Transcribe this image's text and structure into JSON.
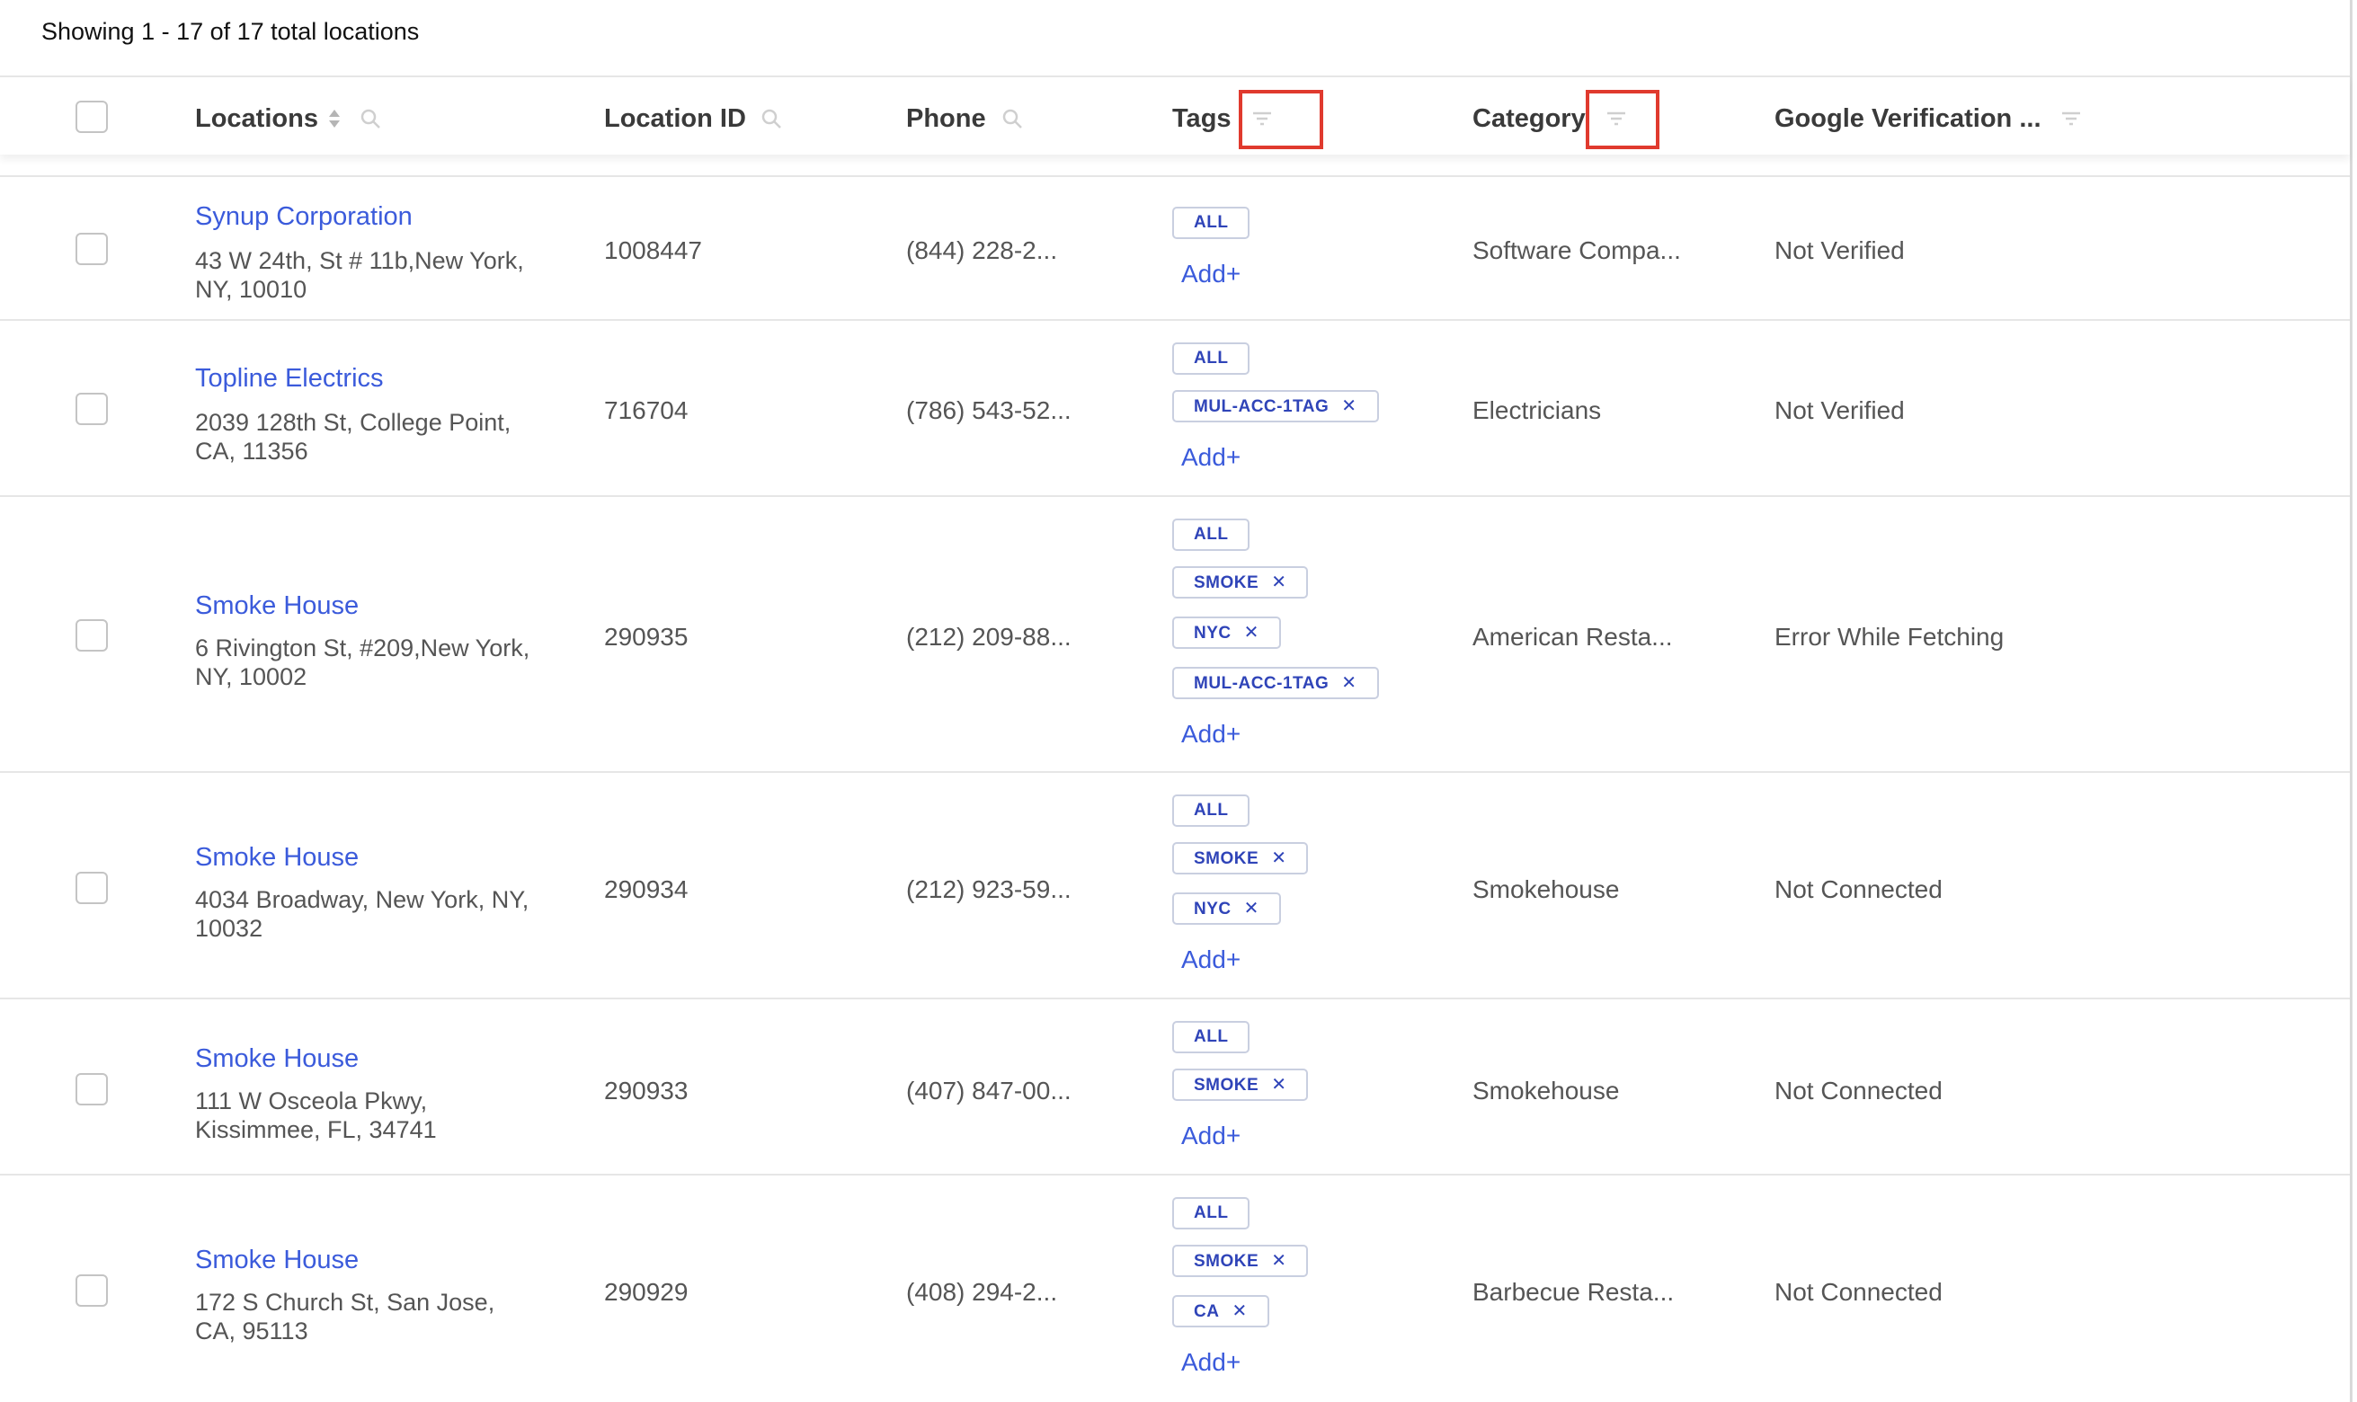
{
  "summary": "Showing 1 - 17 of 17 total locations",
  "header": {
    "locations": "Locations",
    "location_id": "Location ID",
    "phone": "Phone",
    "tags": "Tags",
    "category": "Category",
    "google_verification": "Google Verification ..."
  },
  "colors": {
    "link": "#3b5bdb",
    "tag_text": "#2f44b8",
    "highlight": "#e03a2e"
  },
  "add_label": "Add+",
  "rows": [
    {
      "name": "Synup Corporation",
      "address": "43 W 24th, St # 11b,New York, NY, 10010",
      "id": "1008447",
      "phone": "(844) 228-2...",
      "tags": [
        "ALL"
      ],
      "category": "Software Compa...",
      "verification": "Not Verified"
    },
    {
      "name": "Topline Electrics",
      "address": "2039 128th St, College Point, CA, 11356",
      "id": "716704",
      "phone": "(786) 543-52...",
      "tags": [
        "ALL",
        "MUL-ACC-1TAG"
      ],
      "category": "Electricians",
      "verification": "Not Verified"
    },
    {
      "name": "Smoke House",
      "address": "6 Rivington St, #209,New York, NY, 10002",
      "id": "290935",
      "phone": "(212) 209-88...",
      "tags": [
        "ALL",
        "SMOKE",
        "NYC",
        "MUL-ACC-1TAG"
      ],
      "category": "American Resta...",
      "verification": "Error While Fetching"
    },
    {
      "name": "Smoke House",
      "address": "4034 Broadway, New York, NY, 10032",
      "id": "290934",
      "phone": "(212) 923-59...",
      "tags": [
        "ALL",
        "SMOKE",
        "NYC"
      ],
      "category": "Smokehouse",
      "verification": "Not Connected"
    },
    {
      "name": "Smoke House",
      "address": "111 W Osceola Pkwy, Kissimmee, FL, 34741",
      "id": "290933",
      "phone": "(407) 847-00...",
      "tags": [
        "ALL",
        "SMOKE"
      ],
      "category": "Smokehouse",
      "verification": "Not Connected"
    },
    {
      "name": "Smoke House",
      "address": "172 S Church St, San Jose, CA, 95113",
      "id": "290929",
      "phone": "(408) 294-2...",
      "tags": [
        "ALL",
        "SMOKE",
        "CA"
      ],
      "category": "Barbecue Resta...",
      "verification": "Not Connected"
    }
  ]
}
